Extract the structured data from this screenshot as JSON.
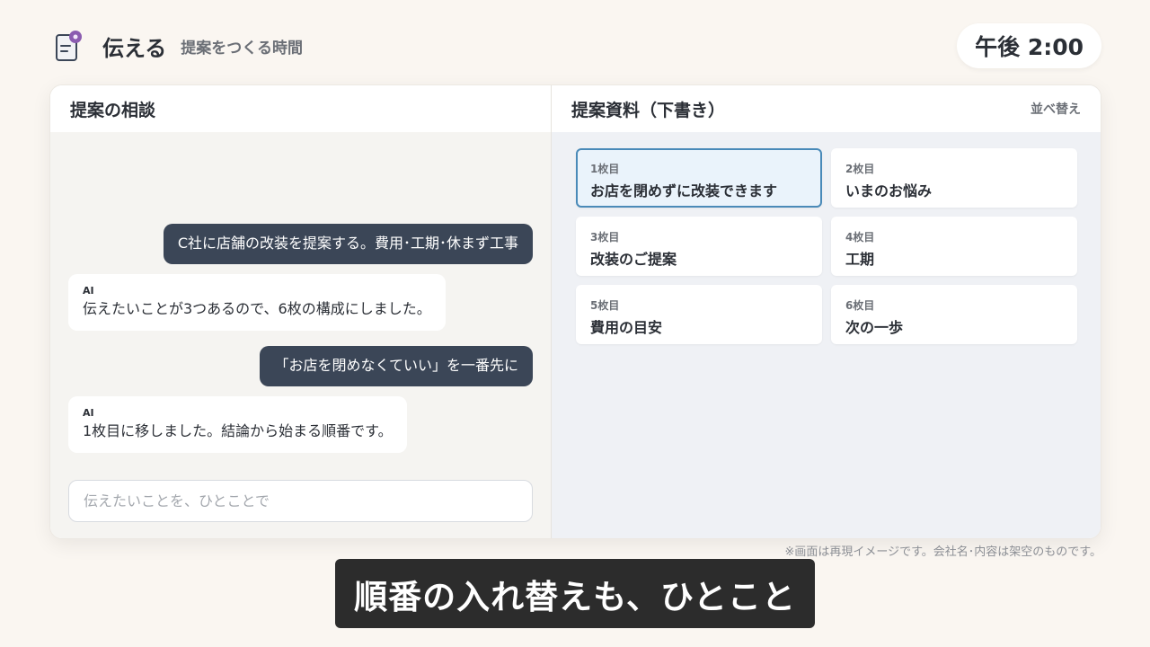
{
  "header": {
    "title": "伝える",
    "subtitle": "提案をつくる時間",
    "icon": "document-pin-icon"
  },
  "clock": {
    "time": "午後 2:00"
  },
  "chat_pane": {
    "title": "提案の相談",
    "messages": [
      {
        "role": "user",
        "text": "C社に店舗の改装を提案する。費用･工期･休まず工事"
      },
      {
        "role": "ai",
        "label": "AI",
        "text": "伝えたいことが3つあるので、6枚の構成にしました。"
      },
      {
        "role": "user",
        "text": "「お店を閉めなくていい」を一番先に"
      },
      {
        "role": "ai",
        "label": "AI",
        "text": "1枚目に移しました。結論から始まる順番です。"
      }
    ],
    "input": {
      "placeholder": "伝えたいことを、ひとことで",
      "value": ""
    }
  },
  "slides_pane": {
    "title": "提案資料（下書き）",
    "sort_label": "並べ替え",
    "slides": [
      {
        "num": "1枚目",
        "title": "お店を閉めずに改装できます",
        "selected": true
      },
      {
        "num": "2枚目",
        "title": "いまのお悩み",
        "selected": false
      },
      {
        "num": "3枚目",
        "title": "改装のご提案",
        "selected": false
      },
      {
        "num": "4枚目",
        "title": "工期",
        "selected": false
      },
      {
        "num": "5枚目",
        "title": "費用の目安",
        "selected": false
      },
      {
        "num": "6枚目",
        "title": "次の一歩",
        "selected": false
      }
    ]
  },
  "disclaimer": "※画面は再現イメージです。会社名･内容は架空のものです。",
  "caption": "順番の入れ替えも、ひとこと",
  "colors": {
    "background": "#faf6f1",
    "user_bubble": "#3b4657",
    "selected_border": "#4a8ab8",
    "accent_pin": "#8b5cb0"
  }
}
